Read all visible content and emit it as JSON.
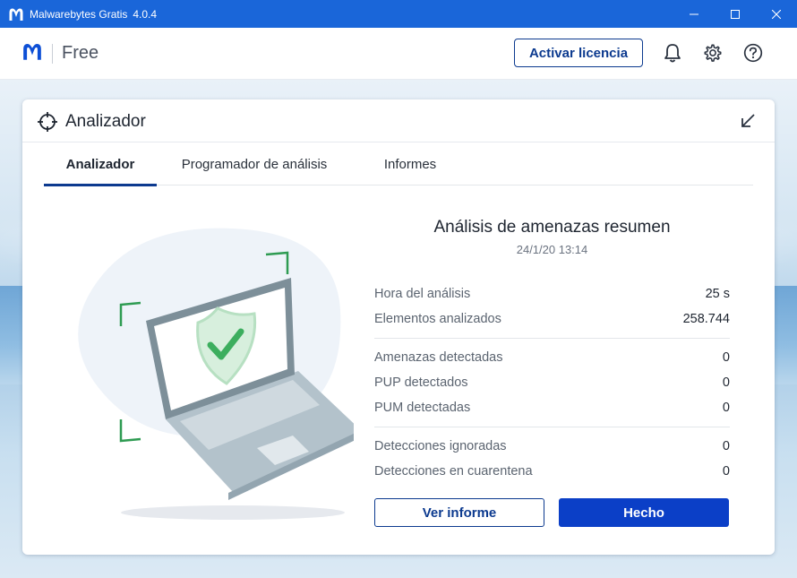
{
  "window": {
    "title": "Malwarebytes Gratis",
    "version": "4.0.4",
    "controls": [
      "minimize-icon",
      "maximize-icon",
      "close-icon"
    ]
  },
  "header": {
    "brand_text": "Free",
    "activate_label": "Activar licencia",
    "icons": [
      "bell-icon",
      "gear-icon",
      "help-icon"
    ]
  },
  "card": {
    "title": "Analizador",
    "tabs": [
      {
        "label": "Analizador",
        "active": true
      },
      {
        "label": "Programador de análisis",
        "active": false
      },
      {
        "label": "Informes",
        "active": false
      }
    ]
  },
  "summary": {
    "title": "Análisis de amenazas resumen",
    "date": "24/1/20 13:14",
    "groups": [
      [
        {
          "label": "Hora del análisis",
          "value": "25 s"
        },
        {
          "label": "Elementos analizados",
          "value": "258.744"
        }
      ],
      [
        {
          "label": "Amenazas detectadas",
          "value": "0"
        },
        {
          "label": "PUP detectados",
          "value": "0"
        },
        {
          "label": "PUM detectadas",
          "value": "0"
        }
      ],
      [
        {
          "label": "Detecciones ignoradas",
          "value": "0"
        },
        {
          "label": "Detecciones en cuarentena",
          "value": "0"
        }
      ]
    ]
  },
  "buttons": {
    "report_label": "Ver informe",
    "done_label": "Hecho"
  },
  "colors": {
    "titlebar": "#1a66d9",
    "brand_blue": "#0c3a8f",
    "done_button": "#0b3fc7",
    "shield_green": "#3cae5e"
  }
}
